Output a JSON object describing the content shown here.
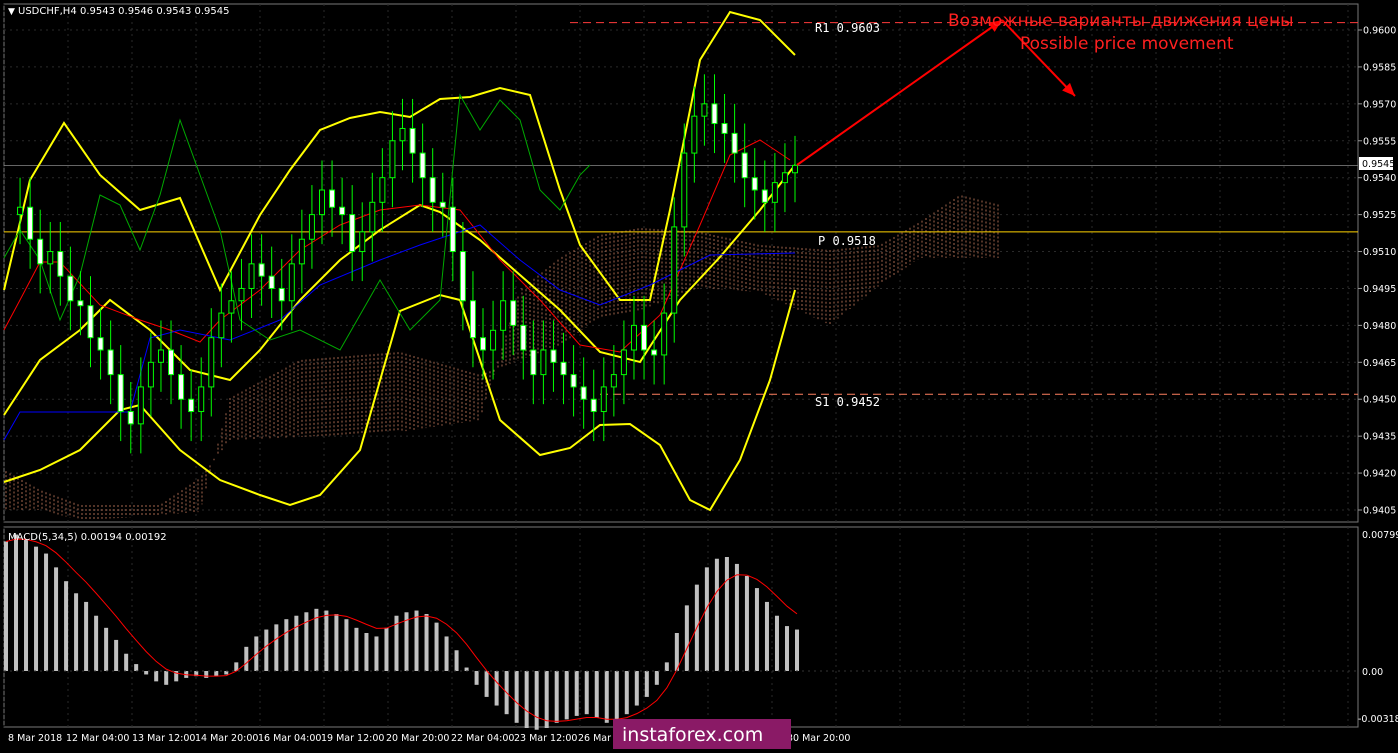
{
  "header": {
    "symbol_label": "USDCHF,H4",
    "ohlc": "0.9543 0.9546 0.9543 0.9545"
  },
  "annotations": {
    "ru": "Возможные варианты движения цены",
    "en": "Possible price movement"
  },
  "levels": [
    {
      "label": "R1 0.9603",
      "price": 0.9603,
      "color": "#ff3b3b",
      "style": "dashed"
    },
    {
      "label": "P 0.9518",
      "price": 0.9518,
      "color": "#ffd300",
      "style": "solid"
    },
    {
      "label": "S1 0.9452",
      "price": 0.9452,
      "color": "#ff8060",
      "style": "dashed"
    }
  ],
  "current_price": "0.9545",
  "macd": {
    "label": "MACD(5,34,5) 0.00194 0.00192",
    "ticks": [
      "0.00799",
      "0.00",
      "-0.00318"
    ]
  },
  "price_ticks": [
    "0.9600",
    "0.9585",
    "0.9570",
    "0.9555",
    "0.9540",
    "0.9525",
    "0.9510",
    "0.9495",
    "0.9480",
    "0.9465",
    "0.9450",
    "0.9435",
    "0.9420",
    "0.9405"
  ],
  "time_ticks": [
    "8 Mar 2018",
    "12 Mar 04:00",
    "13 Mar 12:00",
    "14 Mar 20:00",
    "16 Mar 04:00",
    "19 Mar 12:00",
    "20 Mar 20:00",
    "22 Mar 04:00",
    "23 Mar 12:00",
    "26 Mar 20:00",
    "28 Mar 04:00",
    "29 Mar 12:00",
    "30 Mar 20:00"
  ],
  "watermark": "instaforex.com",
  "colors": {
    "bull": "#00ff00",
    "bollinger": "#ffff00",
    "kijun": "#ff0000",
    "tenkan": "#0000ff",
    "chikou": "#00aa00",
    "cloud": "#ffa07a",
    "macd_bars": "#c0c0c0",
    "macd_signal": "#ff0000",
    "arrows": "#ff0000"
  },
  "chart_data": {
    "type": "line",
    "symbol": "USDCHF",
    "timeframe": "H4",
    "y_axis_range": [
      0.94,
      0.9607
    ],
    "x": [
      "8 Mar 2018",
      "12 Mar 04:00",
      "13 Mar 12:00",
      "14 Mar 20:00",
      "16 Mar 04:00",
      "19 Mar 12:00",
      "20 Mar 20:00",
      "22 Mar 04:00",
      "23 Mar 12:00",
      "26 Mar 20:00",
      "28 Mar 04:00"
    ],
    "series": [
      {
        "name": "",
        "values": [
          0.952,
          0.95,
          0.9455,
          0.9445,
          0.949,
          0.952,
          0.954,
          0.947,
          0.948,
          0.9455,
          0.95
        ]
      }
    ],
    "last_close": 0.9545
  }
}
